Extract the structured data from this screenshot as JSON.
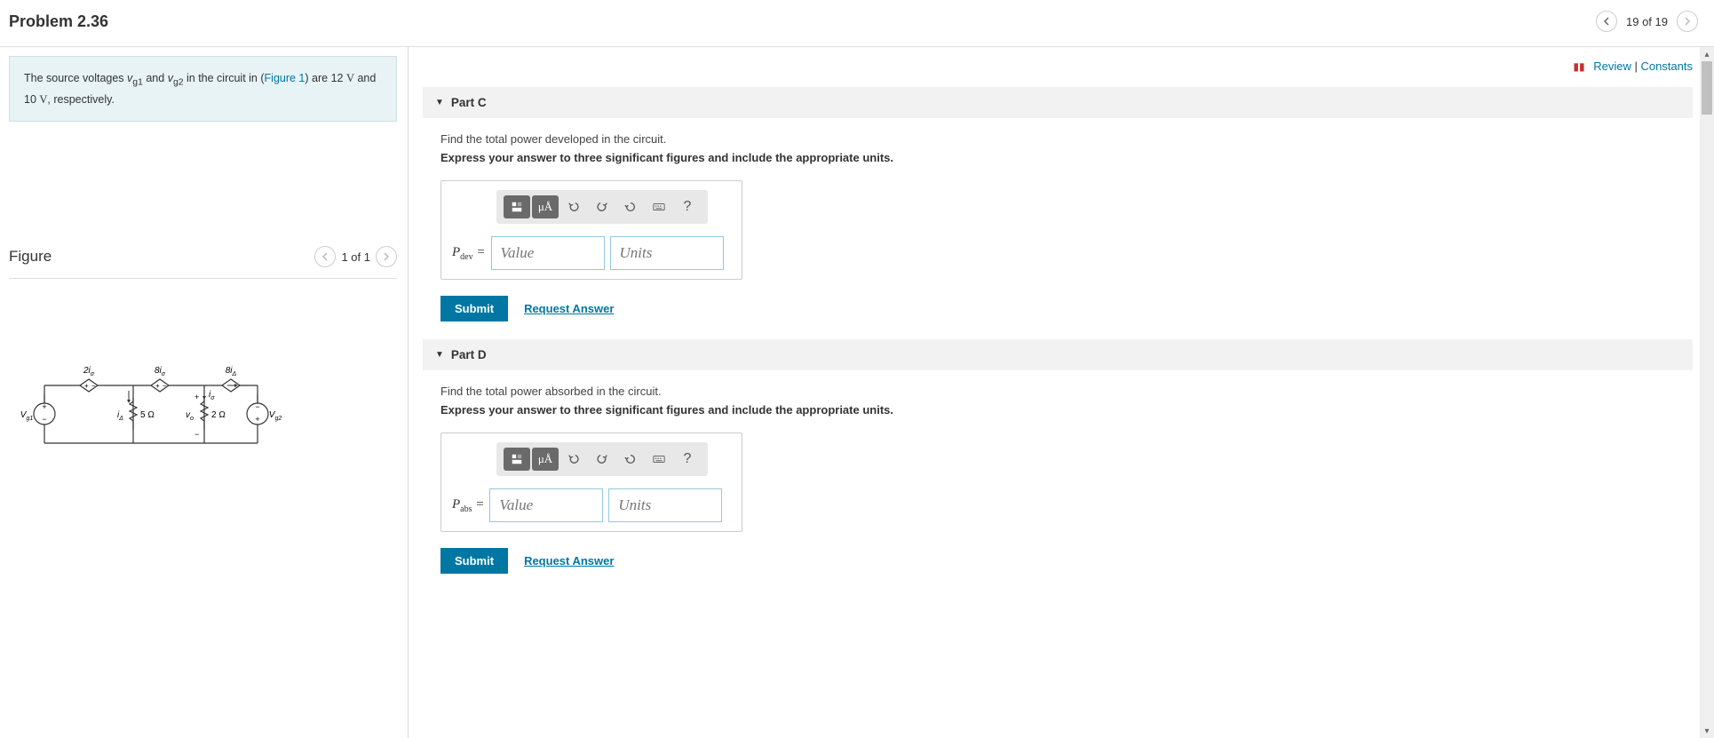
{
  "header": {
    "title": "Problem 2.36",
    "counter": "19 of 19"
  },
  "left": {
    "info_html": "The source voltages ",
    "vg1": "v",
    "vg1_sub": "g1",
    "and1": " and ",
    "vg2": "v",
    "vg2_sub": "g2",
    "mid": " in the circuit in (",
    "figlink": "Figure 1",
    "tail1": ") are 12 ",
    "volt1": "V",
    "tail2": " and 10 ",
    "volt2": "V",
    "tail3": ", respectively.",
    "figure_title": "Figure",
    "figure_count": "1 of 1"
  },
  "circuit": {
    "top1": "2i",
    "top1_sub": "σ",
    "top2": "8i",
    "top2_sub": "σ",
    "top3": "8i",
    "top3_sub": "Δ",
    "vg1": "V",
    "vg1_sub": "g1",
    "ia": "i",
    "ia_sub": "Δ",
    "r1": "5 Ω",
    "io": "i",
    "io_sub": "σ",
    "vo": "v",
    "vo_sub": "o",
    "r2": "2 Ω",
    "vg2": "V",
    "vg2_sub": "g2"
  },
  "toplinks": {
    "review": "Review",
    "sep": " | ",
    "constants": "Constants"
  },
  "parts": [
    {
      "label": "Part C",
      "prompt1": "Find the total power developed in the circuit.",
      "prompt2": "Express your answer to three significant figures and include the appropriate units.",
      "var": "P",
      "var_sub": "dev",
      "value_ph": "Value",
      "units_ph": "Units",
      "submit": "Submit",
      "request": "Request Answer"
    },
    {
      "label": "Part D",
      "prompt1": "Find the total power absorbed in the circuit.",
      "prompt2": "Express your answer to three significant figures and include the appropriate units.",
      "var": "P",
      "var_sub": "abs",
      "value_ph": "Value",
      "units_ph": "Units",
      "submit": "Submit",
      "request": "Request Answer"
    }
  ],
  "toolbar": {
    "units_label": "μÅ",
    "help": "?"
  }
}
